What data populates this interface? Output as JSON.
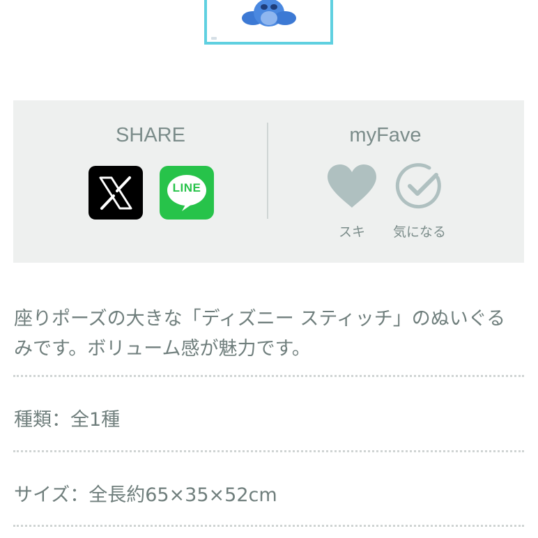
{
  "share": {
    "title": "SHARE",
    "x_label": "X",
    "line_label": "LINE"
  },
  "myfave": {
    "title": "myFave",
    "like_label": "スキ",
    "interested_label": "気になる"
  },
  "product": {
    "description": "座りポーズの大きな「ディズニー スティッチ」のぬいぐるみです。ボリューム感が魅力です。",
    "specs": [
      {
        "text": "種類：全1種"
      },
      {
        "text": "サイズ：全長約65×35×52cm"
      }
    ]
  },
  "colors": {
    "accent_frame": "#5fd0e0",
    "panel_bg": "#eef0ef",
    "x_bg": "#000000",
    "line_bg": "#27c34a",
    "icon_gray": "#afc0c0",
    "text": "#6f7e7c"
  }
}
